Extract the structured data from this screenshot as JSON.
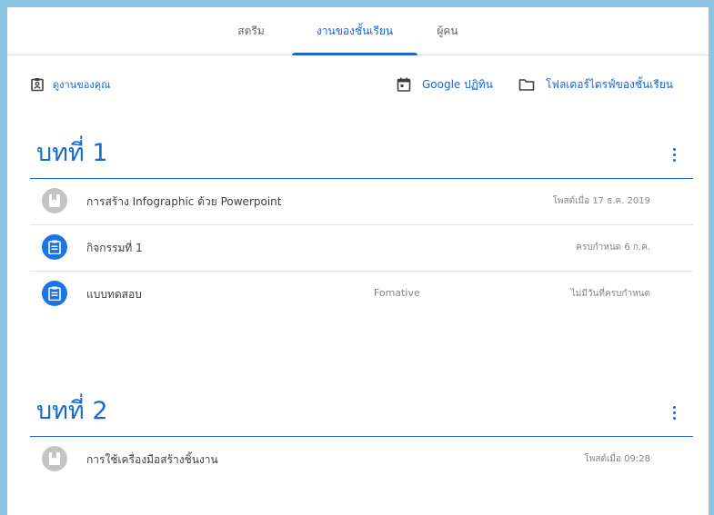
{
  "tabs": [
    {
      "label": "สตรีม",
      "active": false
    },
    {
      "label": "งานของชั้นเรียน",
      "active": true
    },
    {
      "label": "ผู้คน",
      "active": false
    }
  ],
  "actions": {
    "view_work": "ดูงานของคุณ",
    "calendar": "Google ปฏิทิน",
    "drive_folder": "โฟลเดอร์ไดรฟ์ของชั้นเรียน"
  },
  "colors": {
    "accent": "#1967d2",
    "material_icon": "#c4c4c4",
    "assignment_icon": "#1a73e8"
  },
  "topics": [
    {
      "title": "บทที่ 1",
      "items": [
        {
          "title": "การสร้าง Infographic ด้วย Powerpoint",
          "topic": "",
          "meta": "โพสต์เมื่อ 17 ธ.ค. 2019",
          "icon": "material-icon"
        },
        {
          "title": "กิจกรรมที่ 1",
          "topic": "",
          "meta": "ครบกำหนด 6 ก.ค.",
          "icon": "assignment-icon"
        },
        {
          "title": "แบบทดสอบ",
          "topic": "Fomative",
          "meta": "ไม่มีวันที่ครบกำหนด",
          "icon": "assignment-icon"
        }
      ]
    },
    {
      "title": "บทที่ 2",
      "items": [
        {
          "title": "การใช้เครื่องมือสร้างชิ้นงาน",
          "topic": "",
          "meta": "โพสต์เมื่อ 09:28",
          "icon": "material-icon"
        }
      ]
    }
  ]
}
